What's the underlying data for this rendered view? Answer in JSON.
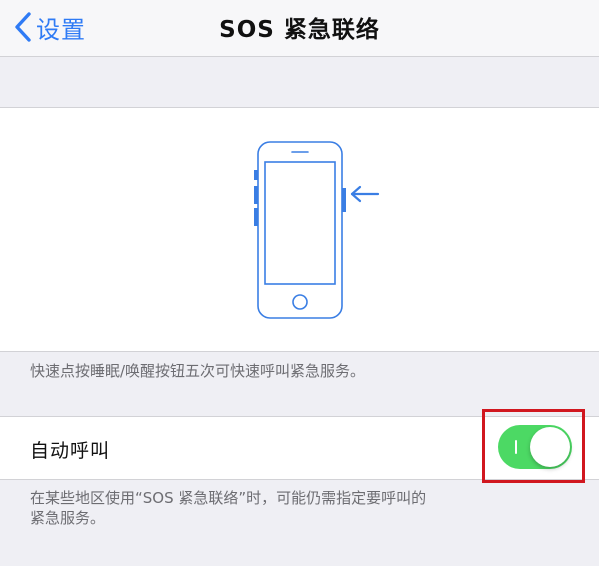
{
  "navbar": {
    "back_label": "设置",
    "back_icon": "chevron-left-icon",
    "title": "SOS 紧急联络"
  },
  "illustration": {
    "icon": "iphone-side-button-icon",
    "arrow_icon": "arrow-left-icon",
    "caption": "快速点按睡眠/唤醒按钮五次可快速呼叫紧急服务。"
  },
  "auto_call": {
    "label": "自动呼叫",
    "enabled": true,
    "caption_line1": "在某些地区使用“SOS 紧急联络”时，可能仍需指定要呼叫的",
    "caption_line2": "紧急服务。"
  },
  "colors": {
    "accent": "#2f7bf5",
    "switch_on": "#4cd964",
    "highlight": "#d1171f",
    "background": "#efeff4"
  }
}
